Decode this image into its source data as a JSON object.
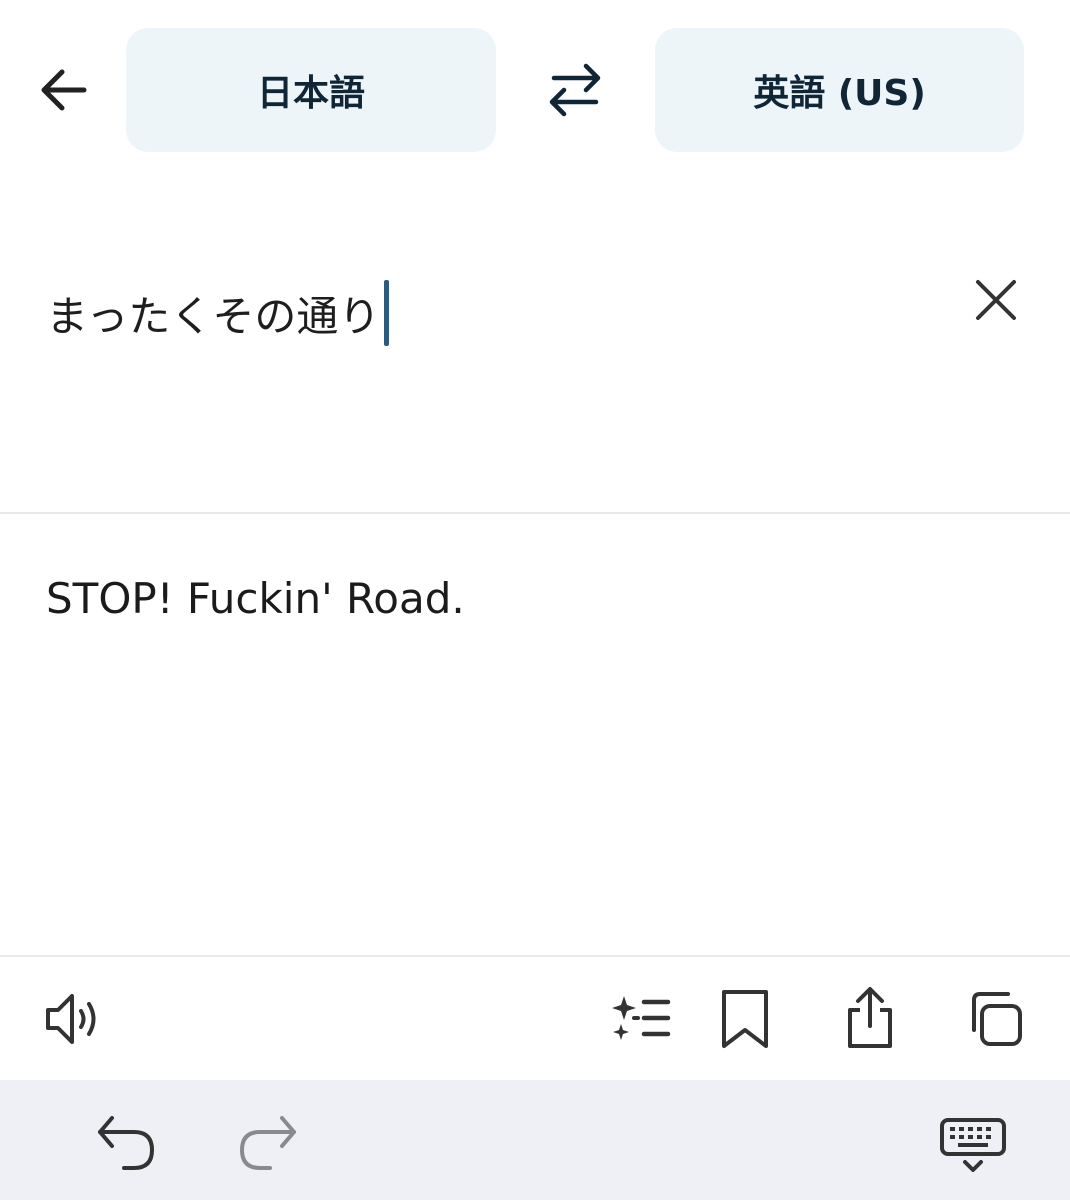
{
  "header": {
    "source_language": "日本語",
    "target_language": "英語 (US)"
  },
  "input": {
    "text": "まったくその通り"
  },
  "output": {
    "translation": "STOP! Fuckin' Road."
  },
  "icons": {
    "back": "arrow-left-icon",
    "swap": "swap-arrows-icon",
    "clear": "close-icon",
    "speak": "speaker-icon",
    "alternatives": "sparkle-list-icon",
    "bookmark": "bookmark-icon",
    "share": "share-icon",
    "copy": "copy-icon",
    "undo": "undo-icon",
    "redo": "redo-icon",
    "keyboard": "keyboard-dismiss-icon"
  },
  "colors": {
    "language_button_bg": "#edf5f9",
    "caret": "#2b5b7e",
    "keyboard_bar_bg": "#eff0f5"
  }
}
